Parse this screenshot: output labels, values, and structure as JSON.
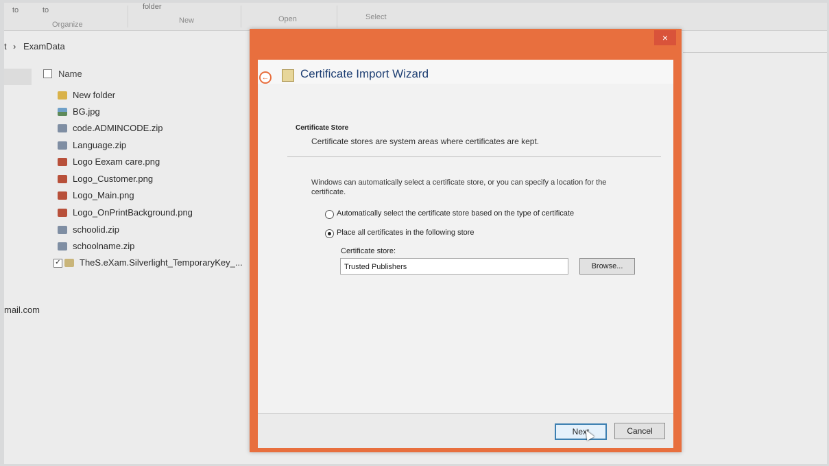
{
  "ribbon": {
    "items": [
      "to",
      "to",
      "folder",
      "New",
      "Open",
      "Select"
    ],
    "group_label": "Organize"
  },
  "address": {
    "crumb_start": "t",
    "separator": "›",
    "folder": "ExamData"
  },
  "file_list": {
    "column_name": "Name",
    "files": [
      {
        "name": "New folder",
        "type": "folder"
      },
      {
        "name": "BG.jpg",
        "type": "image"
      },
      {
        "name": "code.ADMINCODE.zip",
        "type": "zip"
      },
      {
        "name": "Language.zip",
        "type": "zip"
      },
      {
        "name": "Logo Eexam care.png",
        "type": "png"
      },
      {
        "name": "Logo_Customer.png",
        "type": "png"
      },
      {
        "name": "Logo_Main.png",
        "type": "png"
      },
      {
        "name": "Logo_OnPrintBackground.png",
        "type": "png"
      },
      {
        "name": "schoolid.zip",
        "type": "zip"
      },
      {
        "name": "schoolname.zip",
        "type": "zip"
      },
      {
        "name": "TheS.eXam.Silverlight_TemporaryKey_...",
        "type": "cert",
        "selected": true
      }
    ]
  },
  "side_text": "mail.com",
  "dialog": {
    "title": "Certificate Import Wizard",
    "close_glyph": "×",
    "back_glyph": "←",
    "section_title": "Certificate Store",
    "section_desc": "Certificate stores are system areas where certificates are kept.",
    "intro": "Windows can automatically select a certificate store, or you can specify a location for the certificate.",
    "radio_auto": "Automatically select the certificate store based on the type of certificate",
    "radio_place": "Place all certificates in the following store",
    "selected_option": "place",
    "store_label": "Certificate store:",
    "store_value": "Trusted Publishers",
    "browse_label": "Browse...",
    "next_label": "Next",
    "cancel_label": "Cancel",
    "accent_color": "#e86f3e"
  }
}
